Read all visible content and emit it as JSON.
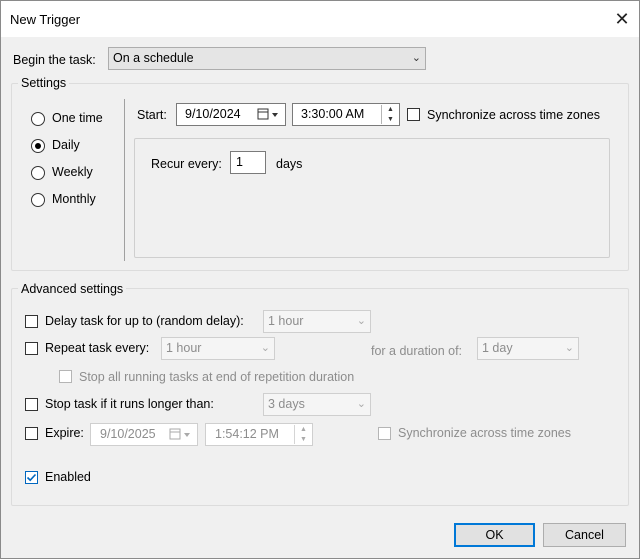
{
  "window": {
    "title": "New Trigger",
    "close_icon": "close-icon"
  },
  "begin": {
    "label": "Begin the task:",
    "value": "On a schedule"
  },
  "settings": {
    "legend": "Settings",
    "schedule_types": [
      "One time",
      "Daily",
      "Weekly",
      "Monthly"
    ],
    "selected": "Daily",
    "start_label": "Start:",
    "start_date": "9/10/2024",
    "start_time": "3:30:00 AM",
    "sync_label": "Synchronize across time zones",
    "recur_label": "Recur every:",
    "recur_value": "1",
    "recur_unit": "days"
  },
  "advanced": {
    "legend": "Advanced settings",
    "delay_label": "Delay task for up to (random delay):",
    "delay_value": "1 hour",
    "repeat_label": "Repeat task every:",
    "repeat_value": "1 hour",
    "duration_label": "for a duration of:",
    "duration_value": "1 day",
    "stop_all_label": "Stop all running tasks at end of repetition duration",
    "stop_longer_label": "Stop task if it runs longer than:",
    "stop_longer_value": "3 days",
    "expire_label": "Expire:",
    "expire_date": "9/10/2025",
    "expire_time": "1:54:12 PM",
    "expire_sync_label": "Synchronize across time zones",
    "enabled_label": "Enabled",
    "enabled": true
  },
  "buttons": {
    "ok": "OK",
    "cancel": "Cancel"
  }
}
